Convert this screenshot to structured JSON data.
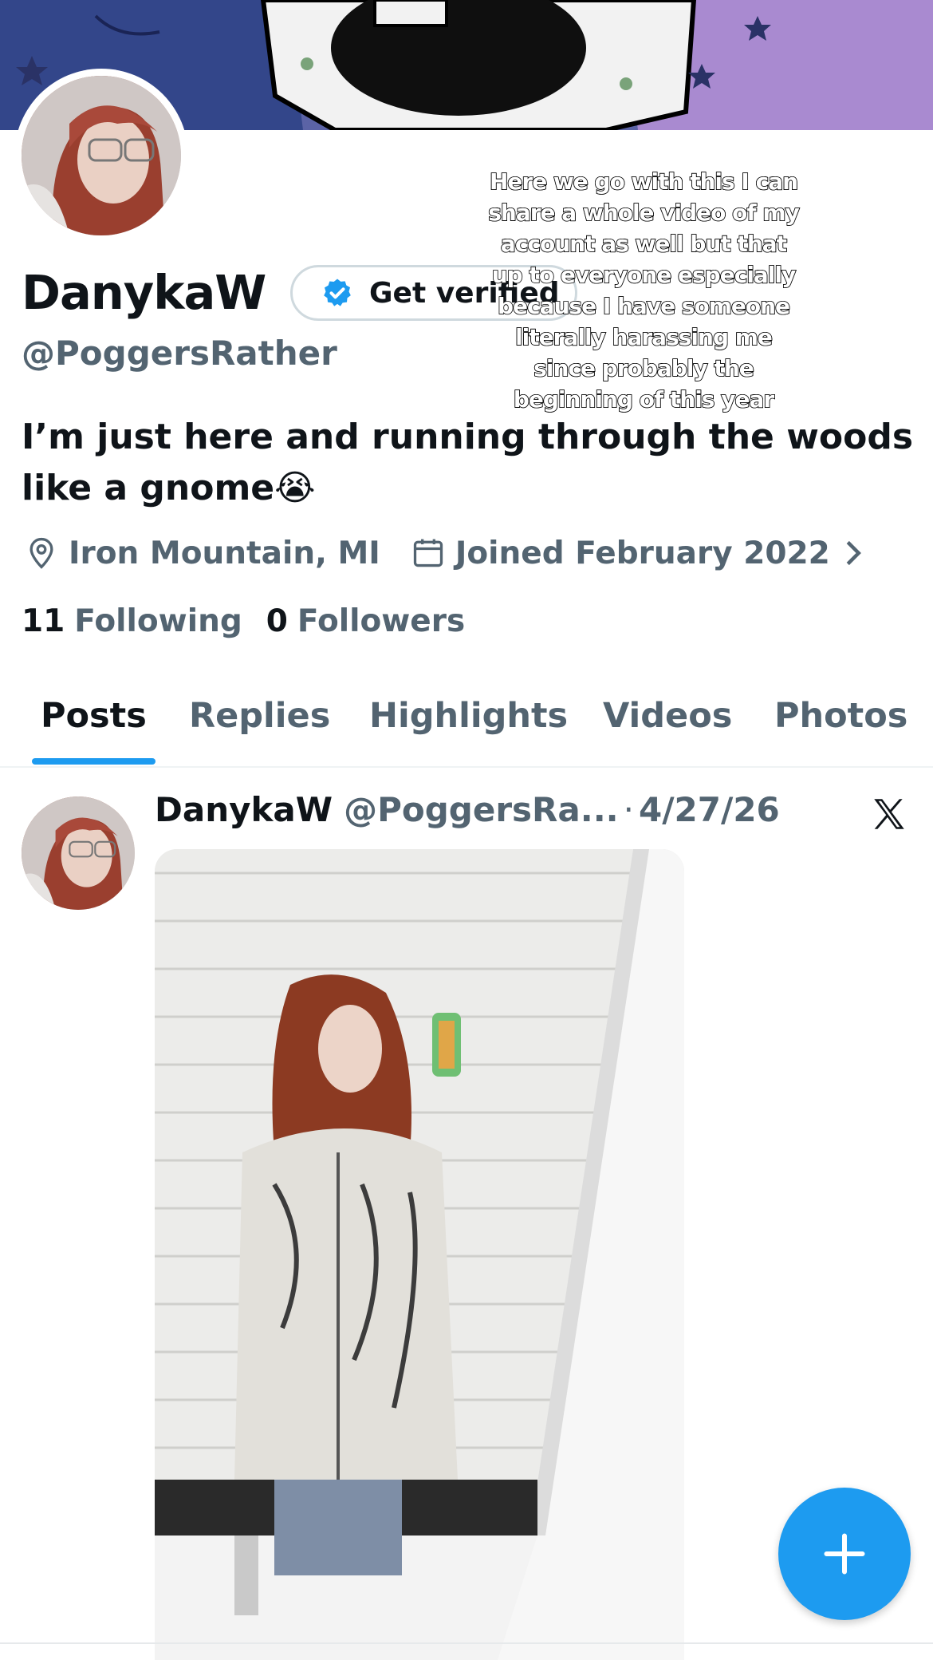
{
  "profile": {
    "display_name": "DanykaW",
    "handle": "@PoggersRather",
    "verify_button_label": "Get verified",
    "bio": "I’m just here and running through the woods like a gnome",
    "bio_emoji": "😭",
    "location": "Iron Mountain, MI",
    "joined": "Joined February 2022",
    "following_count": "11",
    "following_label": "Following",
    "followers_count": "0",
    "followers_label": "Followers"
  },
  "caption": {
    "lines": [
      "Here we go with this I can",
      "share a whole video of my",
      "account as well but that",
      "up to everyone especially",
      "because I have someone",
      "literally harassing me",
      "since probably the",
      "beginning of this year"
    ]
  },
  "tabs": [
    {
      "label": "Posts",
      "active": true
    },
    {
      "label": "Replies",
      "active": false
    },
    {
      "label": "Highlights",
      "active": false
    },
    {
      "label": "Videos",
      "active": false
    },
    {
      "label": "Photos",
      "active": false
    }
  ],
  "post": {
    "name": "DanykaW",
    "handle": "@PoggersRa...",
    "separator": "·",
    "date": "4/27/26",
    "source_icon": "x-logo-icon"
  },
  "icons": {
    "location": "location-pin-icon",
    "calendar": "calendar-icon",
    "chevron": "chevron-right-icon",
    "verified": "verified-badge-icon",
    "compose": "plus-icon"
  },
  "colors": {
    "accent": "#1d9bf0",
    "secondary_text": "#536471",
    "primary_text": "#0f1419"
  }
}
